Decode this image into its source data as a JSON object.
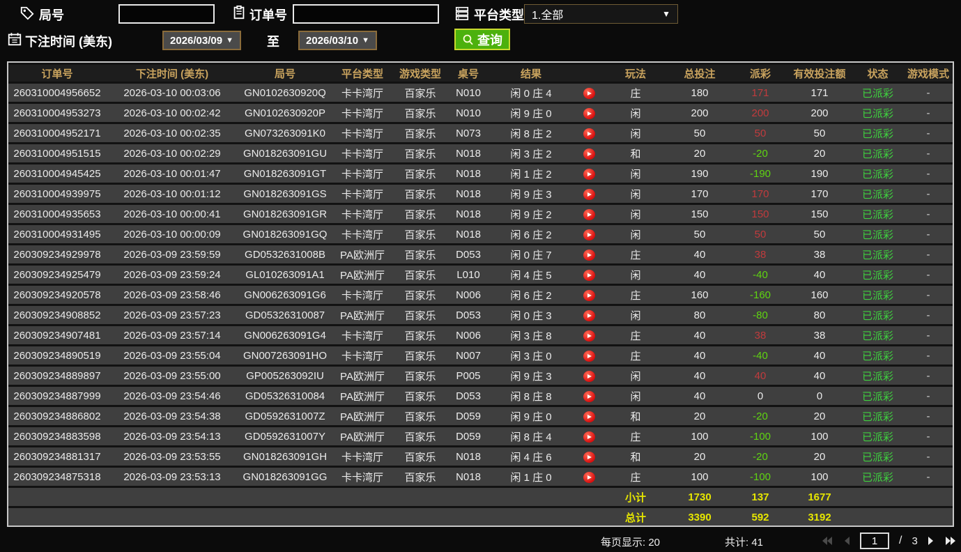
{
  "filters": {
    "game_no": {
      "label": "局号",
      "value": ""
    },
    "order_no": {
      "label": "订单号",
      "value": ""
    },
    "platform": {
      "label": "平台类型",
      "value": "1.全部"
    },
    "bet_time": {
      "label": "下注时间 (美东)",
      "from": "2026/03/09",
      "to_label": "至",
      "to": "2026/03/10"
    },
    "query": {
      "label": "查询"
    }
  },
  "icons": {
    "caret_down": "▼"
  },
  "colors": {
    "header_gold": "#c9a35e",
    "win_red": "#c13b3d",
    "loss_green": "#5fd411",
    "status_green": "#3fd13f",
    "summary_yellow": "#e6e600",
    "query_green": "#4cb10d"
  },
  "table": {
    "columns": [
      "订单号",
      "下注时间 (美东)",
      "局号",
      "平台类型",
      "游戏类型",
      "桌号",
      "结果",
      "",
      "玩法",
      "总投注",
      "派彩",
      "有效投注额",
      "状态",
      "游戏模式"
    ],
    "rows": [
      {
        "order_no": "260310004956652",
        "bet_time": "2026-03-10 00:03:06",
        "game_no": "GN0102630920Q",
        "platform": "卡卡湾厅",
        "game_type": "百家乐",
        "table_no": "N010",
        "result": "闲 0 庄 4",
        "play": "庄",
        "total_bet": "180",
        "payout": "171",
        "payout_color": "red",
        "valid_bet": "171",
        "status": "已派彩",
        "mode": "-"
      },
      {
        "order_no": "260310004953273",
        "bet_time": "2026-03-10 00:02:42",
        "game_no": "GN0102630920P",
        "platform": "卡卡湾厅",
        "game_type": "百家乐",
        "table_no": "N010",
        "result": "闲 9 庄 0",
        "play": "闲",
        "total_bet": "200",
        "payout": "200",
        "payout_color": "red",
        "valid_bet": "200",
        "status": "已派彩",
        "mode": "-"
      },
      {
        "order_no": "260310004952171",
        "bet_time": "2026-03-10 00:02:35",
        "game_no": "GN073263091K0",
        "platform": "卡卡湾厅",
        "game_type": "百家乐",
        "table_no": "N073",
        "result": "闲 8 庄 2",
        "play": "闲",
        "total_bet": "50",
        "payout": "50",
        "payout_color": "red",
        "valid_bet": "50",
        "status": "已派彩",
        "mode": "-"
      },
      {
        "order_no": "260310004951515",
        "bet_time": "2026-03-10 00:02:29",
        "game_no": "GN018263091GU",
        "platform": "卡卡湾厅",
        "game_type": "百家乐",
        "table_no": "N018",
        "result": "闲 3 庄 2",
        "play": "和",
        "total_bet": "20",
        "payout": "-20",
        "payout_color": "green",
        "valid_bet": "20",
        "status": "已派彩",
        "mode": "-"
      },
      {
        "order_no": "260310004945425",
        "bet_time": "2026-03-10 00:01:47",
        "game_no": "GN018263091GT",
        "platform": "卡卡湾厅",
        "game_type": "百家乐",
        "table_no": "N018",
        "result": "闲 1 庄 2",
        "play": "闲",
        "total_bet": "190",
        "payout": "-190",
        "payout_color": "green",
        "valid_bet": "190",
        "status": "已派彩",
        "mode": "-"
      },
      {
        "order_no": "260310004939975",
        "bet_time": "2026-03-10 00:01:12",
        "game_no": "GN018263091GS",
        "platform": "卡卡湾厅",
        "game_type": "百家乐",
        "table_no": "N018",
        "result": "闲 9 庄 3",
        "play": "闲",
        "total_bet": "170",
        "payout": "170",
        "payout_color": "red",
        "valid_bet": "170",
        "status": "已派彩",
        "mode": "-"
      },
      {
        "order_no": "260310004935653",
        "bet_time": "2026-03-10 00:00:41",
        "game_no": "GN018263091GR",
        "platform": "卡卡湾厅",
        "game_type": "百家乐",
        "table_no": "N018",
        "result": "闲 9 庄 2",
        "play": "闲",
        "total_bet": "150",
        "payout": "150",
        "payout_color": "red",
        "valid_bet": "150",
        "status": "已派彩",
        "mode": "-"
      },
      {
        "order_no": "260310004931495",
        "bet_time": "2026-03-10 00:00:09",
        "game_no": "GN018263091GQ",
        "platform": "卡卡湾厅",
        "game_type": "百家乐",
        "table_no": "N018",
        "result": "闲 6 庄 2",
        "play": "闲",
        "total_bet": "50",
        "payout": "50",
        "payout_color": "red",
        "valid_bet": "50",
        "status": "已派彩",
        "mode": "-"
      },
      {
        "order_no": "260309234929978",
        "bet_time": "2026-03-09 23:59:59",
        "game_no": "GD0532631008B",
        "platform": "PA欧洲厅",
        "game_type": "百家乐",
        "table_no": "D053",
        "result": "闲 0 庄 7",
        "play": "庄",
        "total_bet": "40",
        "payout": "38",
        "payout_color": "red",
        "valid_bet": "38",
        "status": "已派彩",
        "mode": "-"
      },
      {
        "order_no": "260309234925479",
        "bet_time": "2026-03-09 23:59:24",
        "game_no": "GL010263091A1",
        "platform": "PA欧洲厅",
        "game_type": "百家乐",
        "table_no": "L010",
        "result": "闲 4 庄 5",
        "play": "闲",
        "total_bet": "40",
        "payout": "-40",
        "payout_color": "green",
        "valid_bet": "40",
        "status": "已派彩",
        "mode": "-"
      },
      {
        "order_no": "260309234920578",
        "bet_time": "2026-03-09 23:58:46",
        "game_no": "GN006263091G6",
        "platform": "卡卡湾厅",
        "game_type": "百家乐",
        "table_no": "N006",
        "result": "闲 6 庄 2",
        "play": "庄",
        "total_bet": "160",
        "payout": "-160",
        "payout_color": "green",
        "valid_bet": "160",
        "status": "已派彩",
        "mode": "-"
      },
      {
        "order_no": "260309234908852",
        "bet_time": "2026-03-09 23:57:23",
        "game_no": "GD05326310087",
        "platform": "PA欧洲厅",
        "game_type": "百家乐",
        "table_no": "D053",
        "result": "闲 0 庄 3",
        "play": "闲",
        "total_bet": "80",
        "payout": "-80",
        "payout_color": "green",
        "valid_bet": "80",
        "status": "已派彩",
        "mode": "-"
      },
      {
        "order_no": "260309234907481",
        "bet_time": "2026-03-09 23:57:14",
        "game_no": "GN006263091G4",
        "platform": "卡卡湾厅",
        "game_type": "百家乐",
        "table_no": "N006",
        "result": "闲 3 庄 8",
        "play": "庄",
        "total_bet": "40",
        "payout": "38",
        "payout_color": "red",
        "valid_bet": "38",
        "status": "已派彩",
        "mode": "-"
      },
      {
        "order_no": "260309234890519",
        "bet_time": "2026-03-09 23:55:04",
        "game_no": "GN007263091HO",
        "platform": "卡卡湾厅",
        "game_type": "百家乐",
        "table_no": "N007",
        "result": "闲 3 庄 0",
        "play": "庄",
        "total_bet": "40",
        "payout": "-40",
        "payout_color": "green",
        "valid_bet": "40",
        "status": "已派彩",
        "mode": "-"
      },
      {
        "order_no": "260309234889897",
        "bet_time": "2026-03-09 23:55:00",
        "game_no": "GP005263092IU",
        "platform": "PA欧洲厅",
        "game_type": "百家乐",
        "table_no": "P005",
        "result": "闲 9 庄 3",
        "play": "闲",
        "total_bet": "40",
        "payout": "40",
        "payout_color": "red",
        "valid_bet": "40",
        "status": "已派彩",
        "mode": "-"
      },
      {
        "order_no": "260309234887999",
        "bet_time": "2026-03-09 23:54:46",
        "game_no": "GD05326310084",
        "platform": "PA欧洲厅",
        "game_type": "百家乐",
        "table_no": "D053",
        "result": "闲 8 庄 8",
        "play": "闲",
        "total_bet": "40",
        "payout": "0",
        "payout_color": "white",
        "valid_bet": "0",
        "status": "已派彩",
        "mode": "-"
      },
      {
        "order_no": "260309234886802",
        "bet_time": "2026-03-09 23:54:38",
        "game_no": "GD0592631007Z",
        "platform": "PA欧洲厅",
        "game_type": "百家乐",
        "table_no": "D059",
        "result": "闲 9 庄 0",
        "play": "和",
        "total_bet": "20",
        "payout": "-20",
        "payout_color": "green",
        "valid_bet": "20",
        "status": "已派彩",
        "mode": "-"
      },
      {
        "order_no": "260309234883598",
        "bet_time": "2026-03-09 23:54:13",
        "game_no": "GD0592631007Y",
        "platform": "PA欧洲厅",
        "game_type": "百家乐",
        "table_no": "D059",
        "result": "闲 8 庄 4",
        "play": "庄",
        "total_bet": "100",
        "payout": "-100",
        "payout_color": "green",
        "valid_bet": "100",
        "status": "已派彩",
        "mode": "-"
      },
      {
        "order_no": "260309234881317",
        "bet_time": "2026-03-09 23:53:55",
        "game_no": "GN018263091GH",
        "platform": "卡卡湾厅",
        "game_type": "百家乐",
        "table_no": "N018",
        "result": "闲 4 庄 6",
        "play": "和",
        "total_bet": "20",
        "payout": "-20",
        "payout_color": "green",
        "valid_bet": "20",
        "status": "已派彩",
        "mode": "-"
      },
      {
        "order_no": "260309234875318",
        "bet_time": "2026-03-09 23:53:13",
        "game_no": "GN018263091GG",
        "platform": "卡卡湾厅",
        "game_type": "百家乐",
        "table_no": "N018",
        "result": "闲 1 庄 0",
        "play": "庄",
        "total_bet": "100",
        "payout": "-100",
        "payout_color": "green",
        "valid_bet": "100",
        "status": "已派彩",
        "mode": "-"
      }
    ],
    "subtotal": {
      "label": "小计",
      "total_bet": "1730",
      "payout": "137",
      "valid_bet": "1677"
    },
    "total": {
      "label": "总计",
      "total_bet": "3390",
      "payout": "592",
      "valid_bet": "3192"
    }
  },
  "footer": {
    "per_page": {
      "label": "每页显示:",
      "value": "20"
    },
    "total_count": {
      "label": "共计:",
      "value": "41"
    },
    "pager": {
      "page": "1",
      "sep": "/",
      "pages": "3"
    }
  }
}
